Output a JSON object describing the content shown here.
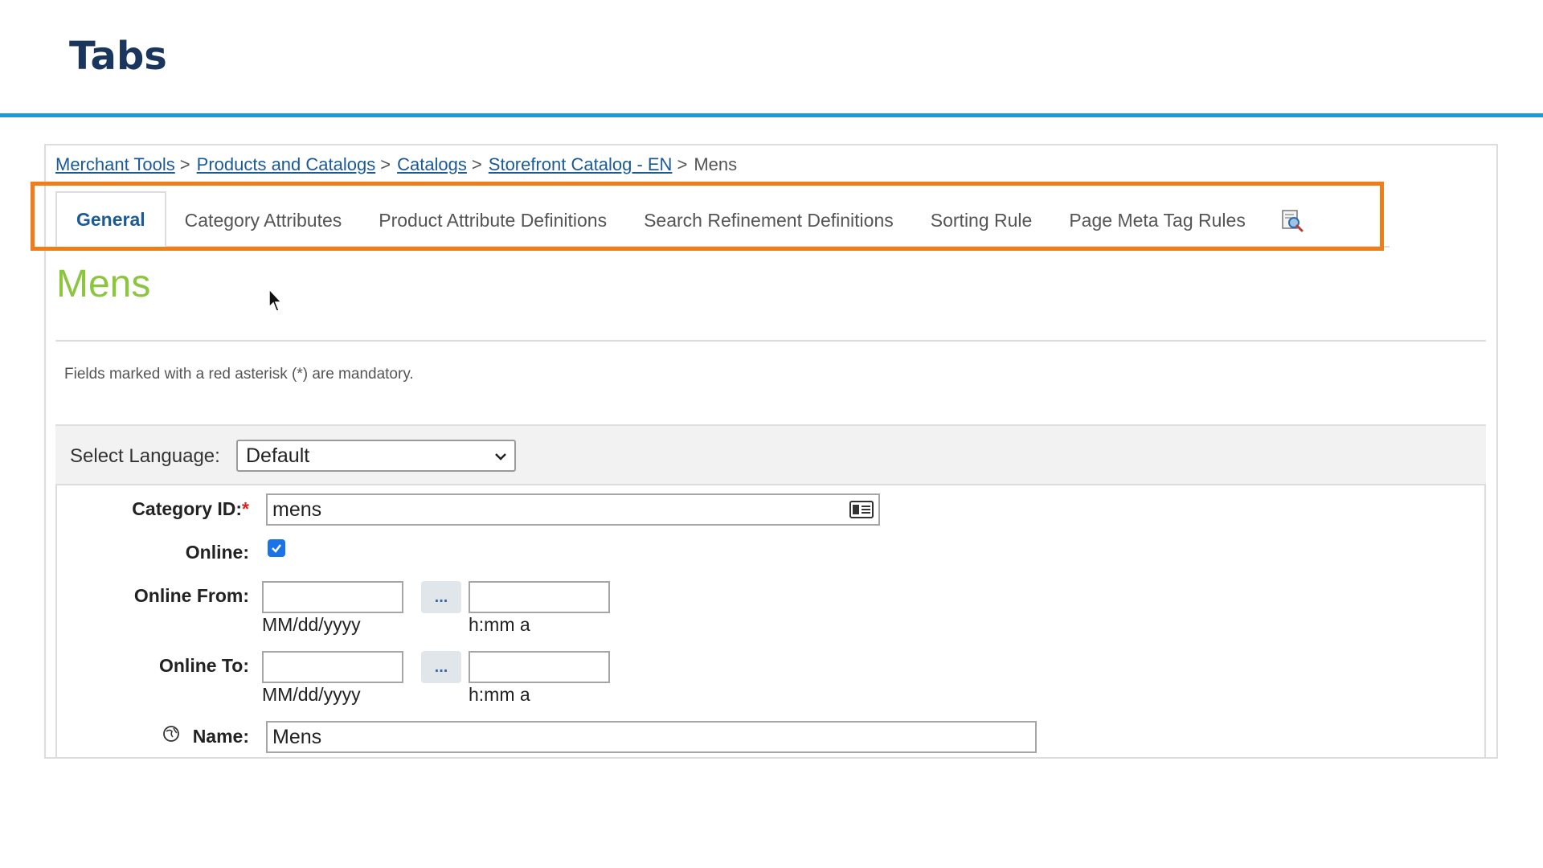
{
  "slide": {
    "title": "Tabs"
  },
  "breadcrumb": {
    "links": [
      "Merchant Tools",
      "Products and Catalogs",
      "Catalogs",
      "Storefront Catalog - EN"
    ],
    "separator": ">",
    "current": "Mens"
  },
  "tabs": [
    {
      "label": "General",
      "active": true
    },
    {
      "label": "Category Attributes",
      "active": false
    },
    {
      "label": "Product Attribute Definitions",
      "active": false
    },
    {
      "label": "Search Refinement Definitions",
      "active": false
    },
    {
      "label": "Sorting Rule",
      "active": false
    },
    {
      "label": "Page Meta Tag Rules",
      "active": false
    }
  ],
  "tab_icon": "preview-search-icon",
  "page": {
    "heading": "Mens",
    "mandatory_note": "Fields marked with a red asterisk (*) are mandatory."
  },
  "language": {
    "label": "Select Language:",
    "selected": "Default"
  },
  "form": {
    "category_id": {
      "label": "Category ID:",
      "required_mark": "*",
      "value": "mens"
    },
    "online": {
      "label": "Online:",
      "checked": true
    },
    "online_from": {
      "label": "Online From:",
      "date_value": "",
      "time_value": "",
      "button": "...",
      "date_hint": "MM/dd/yyyy",
      "time_hint": "h:mm a"
    },
    "online_to": {
      "label": "Online To:",
      "date_value": "",
      "time_value": "",
      "button": "...",
      "date_hint": "MM/dd/yyyy",
      "time_hint": "h:mm a"
    },
    "name": {
      "label": "Name:",
      "value": "Mens"
    }
  },
  "colors": {
    "title": "#1b365d",
    "title_rule": "#1a9ad6",
    "highlight": "#ef7d1a",
    "link": "#1a5a96",
    "heading": "#8cc63f",
    "required": "#e02020",
    "checkbox": "#1a73e8"
  }
}
